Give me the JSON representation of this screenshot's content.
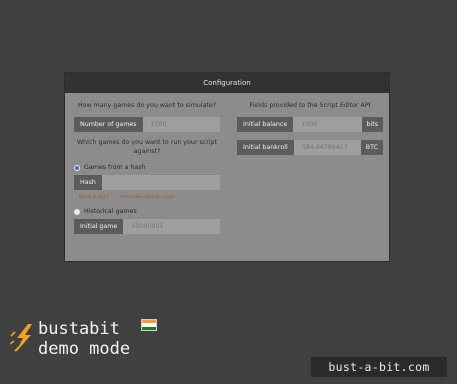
{
  "dialog": {
    "title": "Configuration",
    "left": {
      "question_simulate": "How many games do you want to simulate?",
      "games_label": "Number of games",
      "games_placeholder": "1000",
      "question_run": "Which games do you want to run your script against?",
      "option_hash": "Games from a hash",
      "hash_label": "Hash",
      "hash_value": "",
      "link_what": "What is this?",
      "link_generate": "Generate modulus hash",
      "option_historical": "Historical games",
      "initial_game_label": "Initial game",
      "initial_game_placeholder": "10000001",
      "selected_option": "Games from a hash"
    },
    "right": {
      "fields_title": "Fields provided to the Script Editor API",
      "balance_label": "Initial balance",
      "balance_placeholder": "1000",
      "balance_unit": "bits",
      "bankroll_label": "Initial bankroll",
      "bankroll_placeholder": "584.64786417",
      "bankroll_unit": "BTC"
    }
  },
  "brand": {
    "name": "bustabit",
    "mode": "demo mode",
    "logo_icon": "lightning-bolt-icon",
    "flag_icon": "india-flag-icon"
  },
  "badge": {
    "text": "bust-a-bit.com"
  },
  "colors": {
    "background": "#404040",
    "dialog": "#8c8c8c",
    "header": "#323232",
    "label_bg": "#5c5c5c",
    "link": "#b05a20",
    "bolt": "#f2a31b"
  }
}
